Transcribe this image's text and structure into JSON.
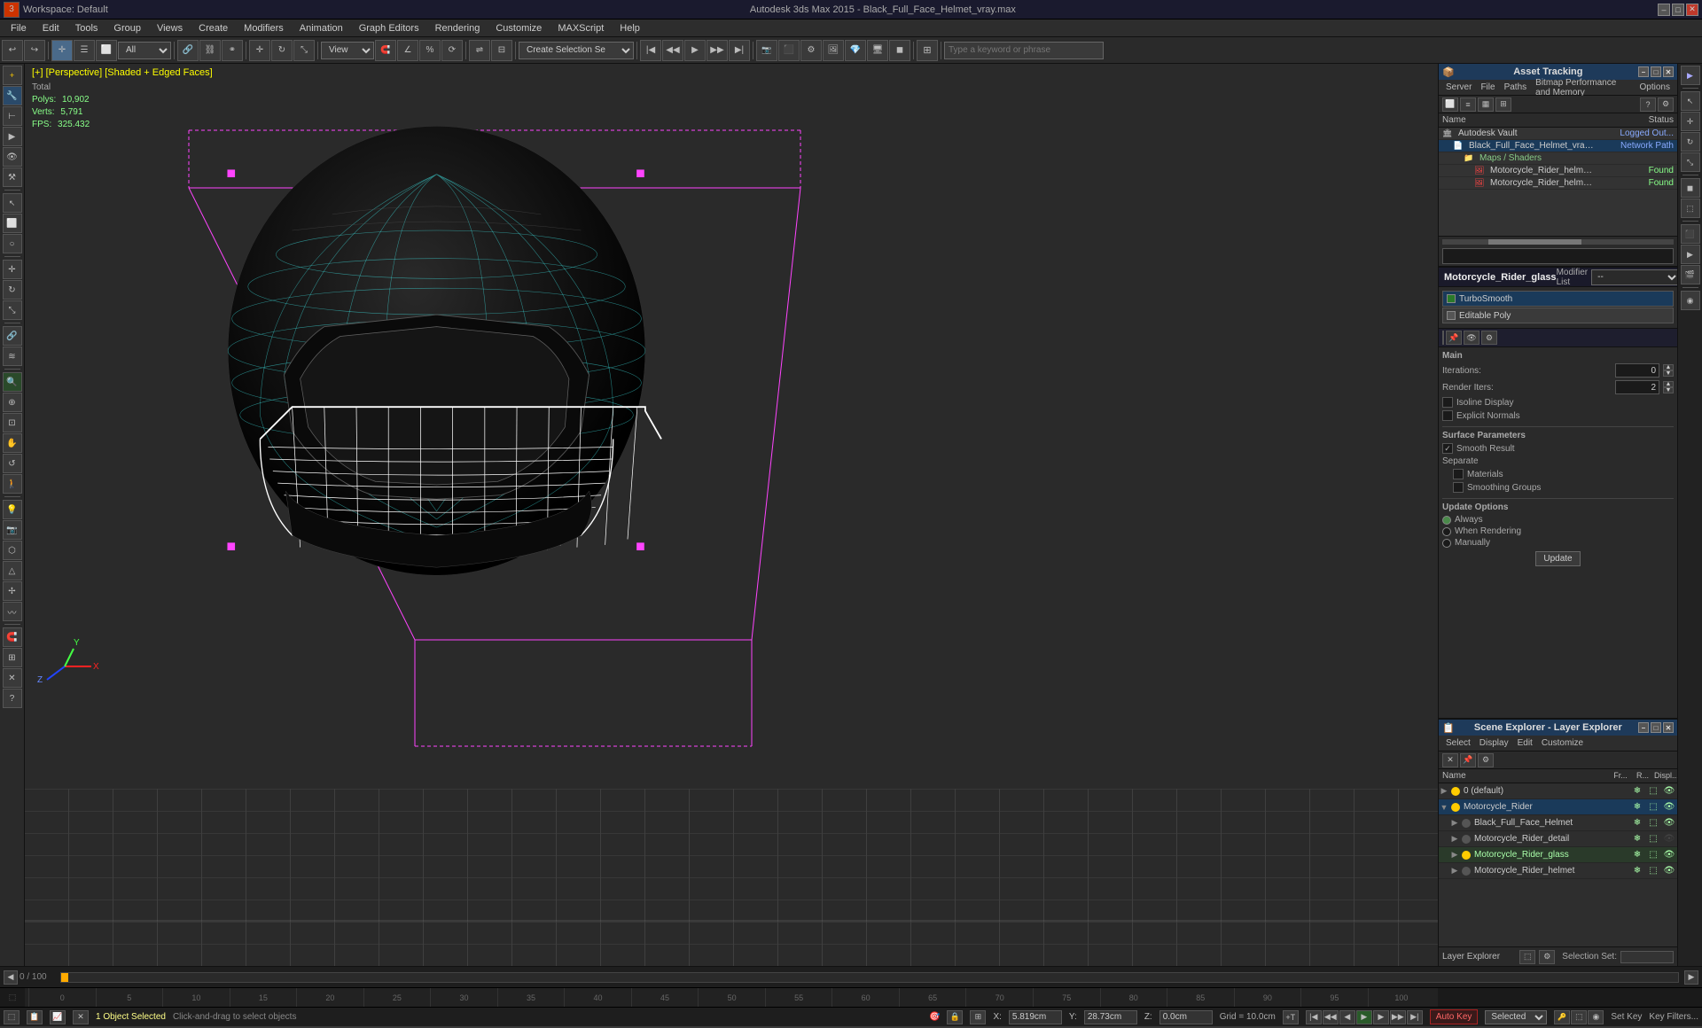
{
  "titlebar": {
    "title": "Autodesk 3ds Max 2015 - Black_Full_Face_Helmet_vray.max",
    "workspace": "Workspace: Default",
    "min": "–",
    "max": "□",
    "close": "✕"
  },
  "menu": {
    "items": [
      "File",
      "Edit",
      "Tools",
      "Group",
      "Views",
      "Create",
      "Modifiers",
      "Animation",
      "Graph Editors",
      "Rendering",
      "Customize",
      "MAXScript",
      "Help"
    ]
  },
  "toolbar1": {
    "undo_label": "↩",
    "redo_label": "↪",
    "select_mode": "All",
    "create_selection": "Create Selection Se",
    "view_dropdown": "View"
  },
  "viewport": {
    "label": "[+] [Perspective] [Shaded + Edged Faces]",
    "polys_label": "Polys:",
    "polys_val": "10,902",
    "verts_label": "Verts:",
    "verts_val": "5,791",
    "fps_label": "FPS:",
    "fps_val": "325.432",
    "total_label": "Total"
  },
  "asset_panel": {
    "title": "Asset Tracking",
    "menu_items": [
      "Server",
      "File",
      "Paths",
      "Bitmap Performance and Memory",
      "Options"
    ],
    "col_name": "Name",
    "col_status": "Status",
    "rows": [
      {
        "indent": 0,
        "icon": "vault",
        "name": "Autodesk Vault",
        "status": "Logged Out..."
      },
      {
        "indent": 1,
        "icon": "file",
        "name": "Black_Full_Face_Helmet_vray.max",
        "status": "Network Path"
      },
      {
        "indent": 2,
        "icon": "folder",
        "name": "Maps / Shaders",
        "status": ""
      },
      {
        "indent": 3,
        "icon": "map",
        "name": "Motorcycle_Rider_helmet.png",
        "status": "Found"
      },
      {
        "indent": 3,
        "icon": "map",
        "name": "Motorcycle_Rider_helmet_normal.png",
        "status": "Found"
      }
    ]
  },
  "layer_panel": {
    "title": "Scene Explorer - Layer Explorer",
    "menu_items": [
      "Select",
      "Display",
      "Edit",
      "Customize"
    ],
    "col_name": "Name",
    "col_fr": "Fr...",
    "col_r": "R...",
    "col_disp": "Displ...",
    "rows": [
      {
        "indent": 0,
        "expanded": false,
        "dot": "active",
        "name": "0 (default)",
        "fr": true,
        "r": true,
        "disp": true
      },
      {
        "indent": 0,
        "expanded": true,
        "dot": "active",
        "name": "Motorcycle_Rider",
        "fr": true,
        "r": true,
        "disp": true,
        "selected": true
      },
      {
        "indent": 1,
        "expanded": false,
        "dot": "inactive",
        "name": "Black_Full_Face_Helmet",
        "fr": true,
        "r": true,
        "disp": true
      },
      {
        "indent": 1,
        "expanded": false,
        "dot": "inactive",
        "name": "Motorcycle_Rider_detail",
        "fr": true,
        "r": true,
        "disp": false
      },
      {
        "indent": 1,
        "expanded": false,
        "dot": "active",
        "name": "Motorcycle_Rider_glass",
        "fr": true,
        "r": true,
        "disp": true,
        "highlighted": true
      },
      {
        "indent": 1,
        "expanded": false,
        "dot": "inactive",
        "name": "Motorcycle_Rider_helmet",
        "fr": true,
        "r": true,
        "disp": true
      }
    ],
    "footer_name": "Layer Explorer",
    "selection_set_label": "Selection Set:"
  },
  "modifier_panel": {
    "obj_name": "Motorcycle_Rider_glass",
    "modifier_list_label": "Modifier List",
    "modifiers": [
      {
        "name": "TurboSmooth",
        "active": true
      },
      {
        "name": "Editable Poly",
        "active": false
      }
    ],
    "turbosmooth": {
      "section": "Main",
      "iterations_label": "Iterations:",
      "iterations_val": "0",
      "render_iters_label": "Render Iters:",
      "render_iters_val": "2",
      "isoline_label": "Isoline Display",
      "explicit_label": "Explicit Normals"
    },
    "surface_params": {
      "title": "Surface Parameters",
      "smooth_result_label": "Smooth Result",
      "separate_label": "Separate",
      "materials_label": "Materials",
      "smoothing_groups_label": "Smoothing Groups"
    },
    "update_options": {
      "title": "Update Options",
      "always_label": "Always",
      "when_rendering_label": "When Rendering",
      "manually_label": "Manually",
      "update_btn": "Update"
    }
  },
  "timeline": {
    "start": "0",
    "end": "100",
    "current": "0 / 100",
    "ticks": [
      "0",
      "5",
      "10",
      "15",
      "20",
      "25",
      "30",
      "35",
      "40",
      "45",
      "50",
      "55",
      "60",
      "65",
      "70",
      "75",
      "80",
      "85",
      "90",
      "95",
      "100"
    ]
  },
  "status_bar": {
    "object_selected": "1 Object Selected",
    "hint": "Click-and-drag to select objects",
    "auto_key_label": "Auto Key",
    "selected_label": "Selected",
    "set_key_label": "Set Key",
    "key_filters_label": "Key Filters...",
    "x_label": "X:",
    "x_val": "5.819cm",
    "y_label": "Y:",
    "y_val": "28.73cm",
    "z_label": "Z:",
    "z_val": "0.0cm",
    "grid_label": "Grid = 10.0cm",
    "add_time_tag": "Add Time Tag"
  },
  "icons": {
    "expand_arrow": "▶",
    "collapse_arrow": "▼",
    "sun": "☀",
    "eye": "👁",
    "lock": "🔒",
    "gear": "⚙",
    "search": "🔍",
    "close": "✕",
    "check": "✓",
    "move": "✛",
    "rotate": "↻",
    "scale": "⤡",
    "render": "⬛",
    "camera": "📷",
    "light": "💡",
    "layer": "⬚",
    "freeze": "❄",
    "visible": "○",
    "hidden": "◉"
  }
}
